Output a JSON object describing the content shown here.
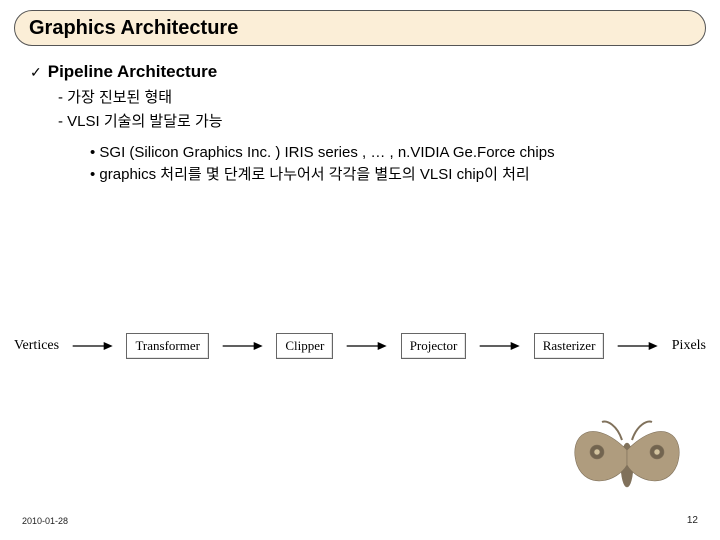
{
  "slide": {
    "title": "Graphics Architecture",
    "check_icon": "✓",
    "lvl1": "Pipeline Architecture",
    "lvl2": {
      "item1": "가장 진보된 형태",
      "item2": "VLSI 기술의 발달로 가능"
    },
    "lvl3": {
      "item1": "SGI (Silicon Graphics Inc. ) IRIS series , … , n.VIDIA Ge.Force chips",
      "item2": "graphics 처리를 몇 단계로 나누어서 각각을 별도의 VLSI chip이 처리"
    }
  },
  "pipeline": {
    "in": "Vertices",
    "s1": "Transformer",
    "s2": "Clipper",
    "s3": "Projector",
    "s4": "Rasterizer",
    "out": "Pixels"
  },
  "footer": {
    "date": "2010-01-28",
    "page": "12"
  },
  "decor": {
    "moth": "moth-illustration"
  }
}
